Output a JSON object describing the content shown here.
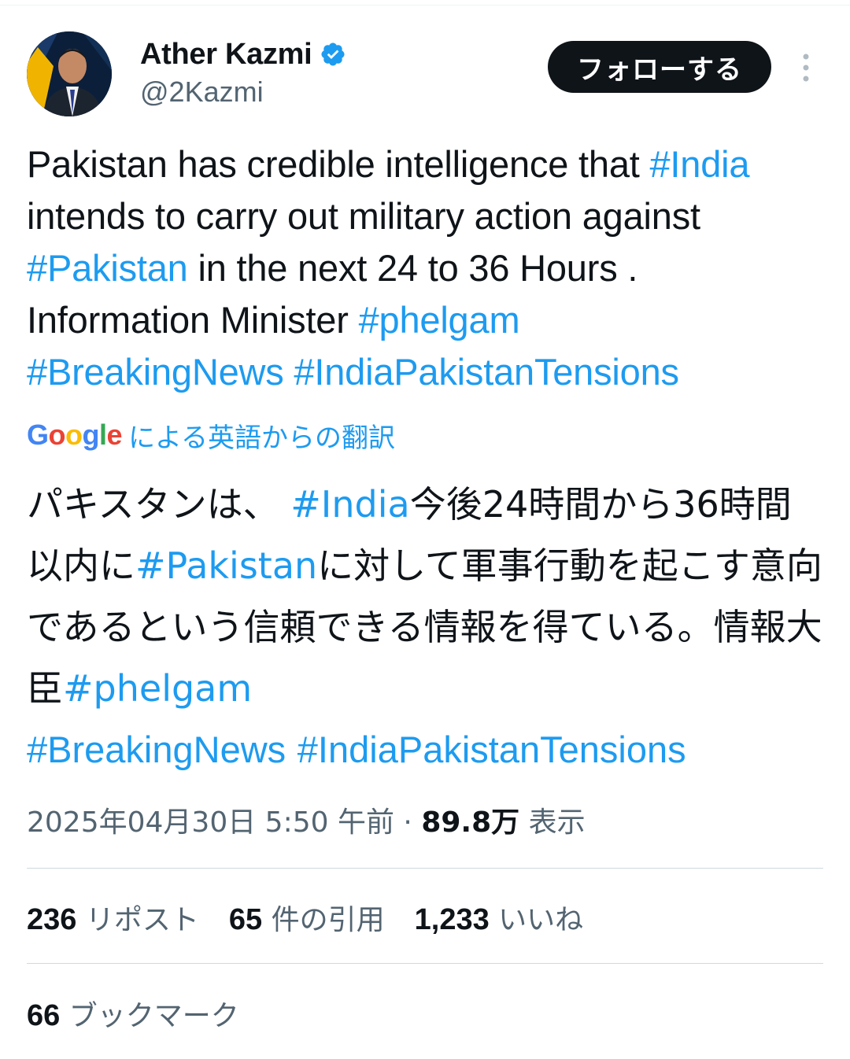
{
  "author": {
    "name": "Ather Kazmi",
    "handle": "@2Kazmi",
    "verified_icon": "verified-badge-icon",
    "verified_color": "#1d9bf0"
  },
  "follow_button": {
    "label": "フォローする"
  },
  "more_menu": {
    "icon": "more-vertical-icon"
  },
  "tweet": {
    "t1": "Pakistan has credible intelligence that ",
    "tag_india": "#India",
    "t2": " intends to carry out military action against ",
    "tag_pakistan": "#Pakistan",
    "t3": " in the next 24 to 36 Hours . Information Minister ",
    "tag_phelgam": "#phelgam",
    "tag_breaking": "#BreakingNews",
    "tag_tensions": "#IndiaPakistanTensions"
  },
  "translation": {
    "google": [
      "G",
      "o",
      "o",
      "g",
      "l",
      "e"
    ],
    "label": "による英語からの翻訳",
    "t1": "パキスタンは、 ",
    "tag_india": "#India",
    "t2": "今後24時間から36時間以内に",
    "tag_pakistan": "#Pakistan",
    "t3": "に対して軍事行動を起こす意向であるという信頼できる情報を得ている。情報大臣",
    "tag_phelgam": "#phelgam",
    "tag_breaking": "#BreakingNews",
    "tag_tensions": "#IndiaPakistanTensions"
  },
  "meta": {
    "timestamp": "2025年04月30日 5:50 午前",
    "separator": "·",
    "views_count": "89.8万",
    "views_label": "表示"
  },
  "stats": {
    "reposts_count": "236",
    "reposts_label": "リポスト",
    "quotes_count": "65",
    "quotes_label": "件の引用",
    "likes_count": "1,233",
    "likes_label": "いいね",
    "bookmarks_count": "66",
    "bookmarks_label": "ブックマーク"
  },
  "colors": {
    "hashtag": "#1d9bf0",
    "text": "#0f1419",
    "muted": "#536471",
    "button_bg": "#0f1419"
  }
}
